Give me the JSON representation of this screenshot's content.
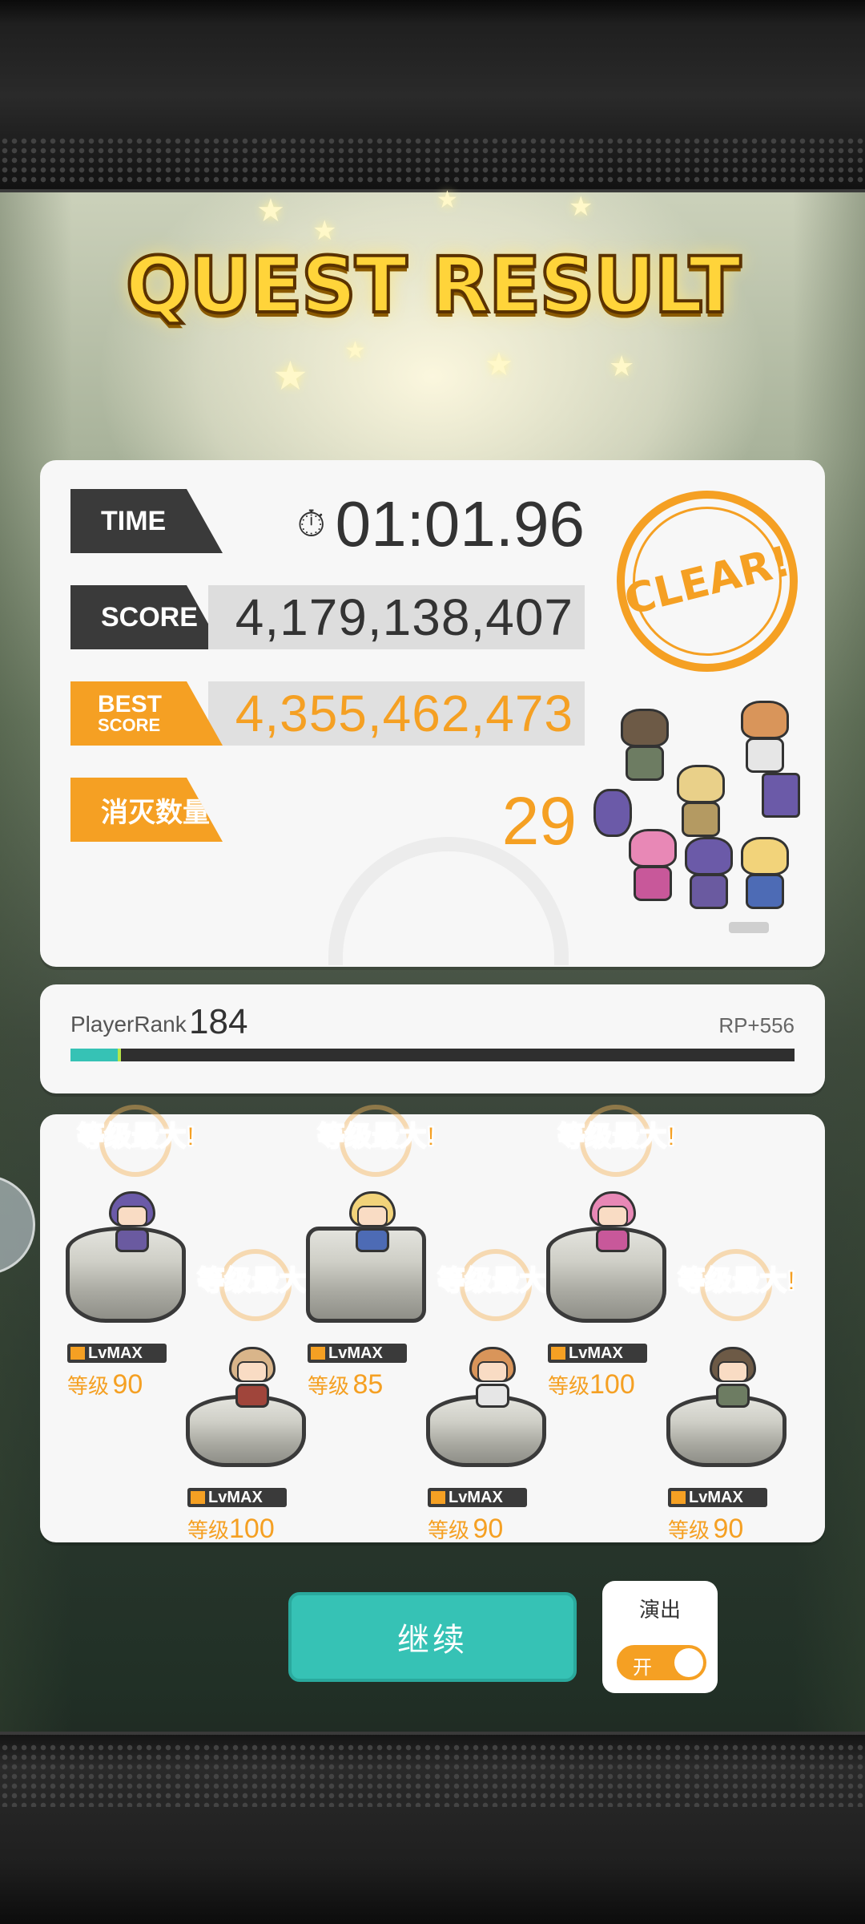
{
  "title": "QUEST RESULT",
  "results": {
    "time_label": "TIME",
    "time_value": "01:01.96",
    "score_label": "SCORE",
    "score_value": "4,179,138,407",
    "best_label_1": "BEST",
    "best_label_2": "SCORE",
    "best_value": "4,355,462,473",
    "kill_label": "消灭数量",
    "kill_value": "29",
    "clear_stamp": "CLEAR!"
  },
  "rank": {
    "label": "PlayerRank",
    "value": "184",
    "rp": "RP+556",
    "progress_percent": 7
  },
  "units": [
    {
      "badge": "等级最大!",
      "lvmax": "LvMAX",
      "lv_prefix": "等级",
      "lv": "90",
      "hair": "#6b5aa8",
      "cloth": "#6a5aa0"
    },
    {
      "badge": "等级最大!",
      "lvmax": "LvMAX",
      "lv_prefix": "等级",
      "lv": "100",
      "hair": "#d9b58a",
      "cloth": "#a0453b"
    },
    {
      "badge": "等级最大!",
      "lvmax": "LvMAX",
      "lv_prefix": "等级",
      "lv": "85",
      "hair": "#f2d37a",
      "cloth": "#4d6bb5"
    },
    {
      "badge": "等级最大!",
      "lvmax": "LvMAX",
      "lv_prefix": "等级",
      "lv": "90",
      "hair": "#d9955a",
      "cloth": "#e6e6e6"
    },
    {
      "badge": "等级最大!",
      "lvmax": "LvMAX",
      "lv_prefix": "等级",
      "lv": "100",
      "hair": "#e888b6",
      "cloth": "#c8589a"
    },
    {
      "badge": "等级最大!",
      "lvmax": "LvMAX",
      "lv_prefix": "等级",
      "lv": "90",
      "hair": "#6d5a46",
      "cloth": "#6d7c62"
    }
  ],
  "actions": {
    "continue_label": "继续",
    "performance_label": "演出",
    "toggle_label": "开",
    "toggle_on": true
  },
  "colors": {
    "accent_orange": "#f5a023",
    "accent_teal": "#36c2b5",
    "dark_tag": "#3a3a3a"
  }
}
